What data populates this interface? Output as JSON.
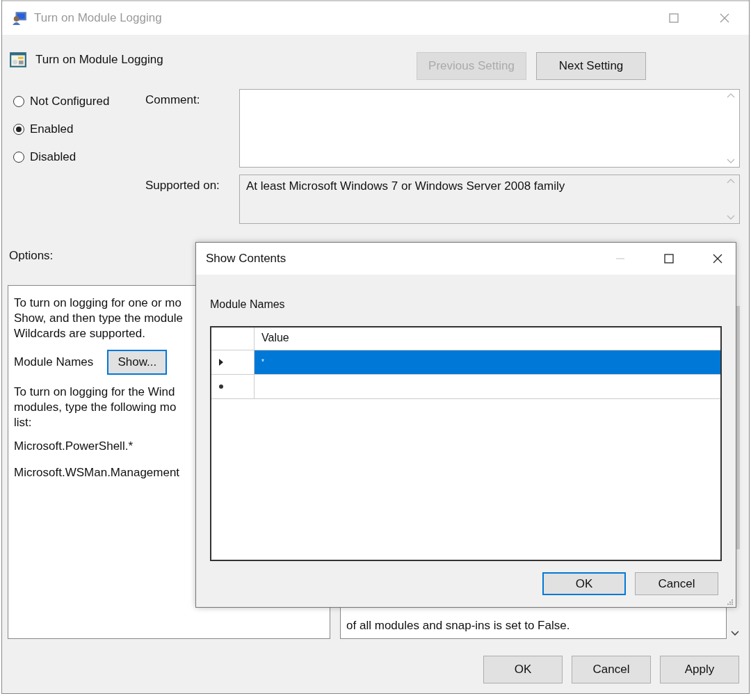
{
  "window": {
    "title": "Turn on Module Logging"
  },
  "setting_title": "Turn on Module Logging",
  "nav_buttons": [
    {
      "label": "Previous Setting",
      "disabled": true
    },
    {
      "label": "Next Setting",
      "disabled": false
    }
  ],
  "states": [
    {
      "label": "Not Configured",
      "selected": false
    },
    {
      "label": "Enabled",
      "selected": true
    },
    {
      "label": "Disabled",
      "selected": false
    }
  ],
  "comment": {
    "label": "Comment:"
  },
  "supported_on": {
    "label": "Supported on:",
    "value": "At least Microsoft Windows 7 or Windows Server 2008 family"
  },
  "options": {
    "label": "Options:",
    "intro_lines": [
      "To turn on logging for one or mo",
      "Show, and then type the module",
      "Wildcards are supported."
    ],
    "module_names_label": "Module Names",
    "show_button": "Show...",
    "windows_lines": [
      "To turn on logging for the Wind",
      "modules, type the following mo",
      "list:"
    ],
    "examples": [
      "Microsoft.PowerShell.*",
      "Microsoft.WSMan.Management"
    ]
  },
  "help": {
    "visible_text": "of all modules and snap-ins is set to False."
  },
  "footer_buttons": [
    {
      "label": "OK"
    },
    {
      "label": "Cancel"
    },
    {
      "label": "Apply"
    }
  ],
  "dialog": {
    "title": "Show Contents",
    "list_label": "Module Names",
    "column": "Value",
    "rows": [
      {
        "kind": "data",
        "value": "*",
        "selected": true
      },
      {
        "kind": "new",
        "selected": false
      }
    ],
    "buttons": [
      {
        "label": "OK",
        "default": true
      },
      {
        "label": "Cancel",
        "default": false
      }
    ]
  }
}
